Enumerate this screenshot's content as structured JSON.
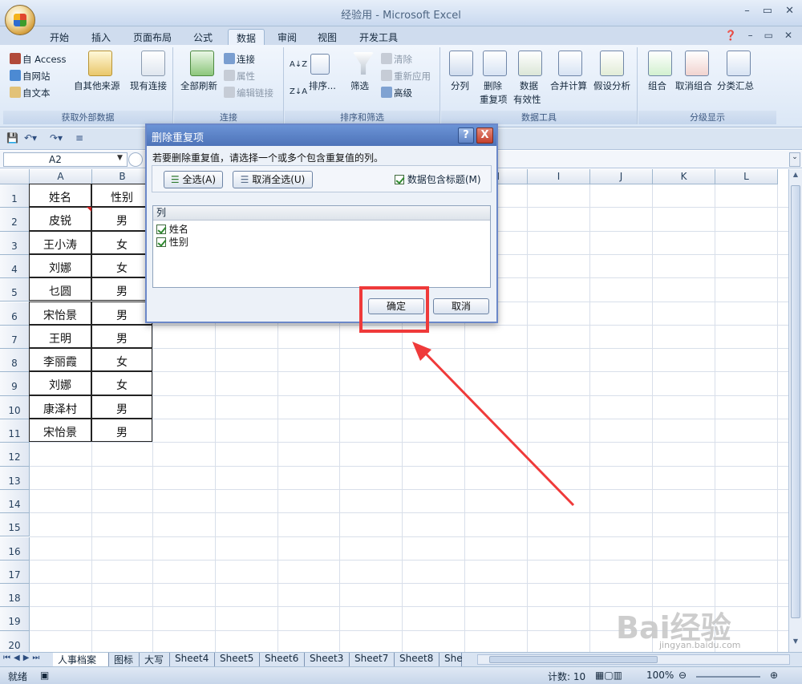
{
  "window": {
    "title": "经验用 - Microsoft Excel"
  },
  "ribbon": {
    "tabs": [
      "开始",
      "插入",
      "页面布局",
      "公式",
      "数据",
      "审阅",
      "视图",
      "开发工具"
    ],
    "active_tab": "数据",
    "groups": {
      "external": {
        "label": "获取外部数据",
        "access": "自 Access",
        "web": "自网站",
        "text": "自文本",
        "other": "自其他来源",
        "existing": "现有连接"
      },
      "connections": {
        "label": "连接",
        "refresh_all": "全部刷新",
        "connections": "连接",
        "properties": "属性",
        "edit_links": "编辑链接"
      },
      "sort_filter": {
        "label": "排序和筛选",
        "sort": "排序...",
        "filter": "筛选",
        "clear": "清除",
        "reapply": "重新应用",
        "advanced": "高级"
      },
      "data_tools": {
        "label": "数据工具",
        "text_to_columns": "分列",
        "remove_dup_1": "删除",
        "remove_dup_2": "重复项",
        "validation_1": "数据",
        "validation_2": "有效性",
        "consolidate": "合并计算",
        "what_if": "假设分析"
      },
      "outline": {
        "label": "分级显示",
        "group": "组合",
        "ungroup": "取消组合",
        "subtotal": "分类汇总"
      }
    }
  },
  "formula_bar": {
    "name_box": "A2"
  },
  "grid": {
    "columns": [
      "A",
      "B",
      "C",
      "D",
      "E",
      "F",
      "G",
      "H",
      "I",
      "J",
      "K",
      "L"
    ],
    "rows": [
      "1",
      "2",
      "3",
      "4",
      "5",
      "6",
      "7",
      "8",
      "9",
      "10",
      "11",
      "12",
      "13",
      "14",
      "15",
      "16",
      "17",
      "18",
      "19",
      "20"
    ],
    "data": [
      [
        "姓名",
        "性别"
      ],
      [
        "皮锐",
        "男"
      ],
      [
        "王小涛",
        "女"
      ],
      [
        "刘娜",
        "女"
      ],
      [
        "乜圆",
        "男"
      ],
      [
        "宋怡景",
        "男"
      ],
      [
        "王明",
        "男"
      ],
      [
        "李丽霞",
        "女"
      ],
      [
        "刘娜",
        "女"
      ],
      [
        "康泽村",
        "男"
      ],
      [
        "宋怡景",
        "男"
      ]
    ]
  },
  "sheets": {
    "tabs": [
      "人事档案",
      "图标",
      "大写",
      "Sheet4",
      "Sheet5",
      "Sheet6",
      "Sheet3",
      "Sheet7",
      "Sheet8",
      "She"
    ],
    "active": "人事档案"
  },
  "status": {
    "ready": "就绪",
    "count": "计数: 10",
    "zoom": "100%"
  },
  "dialog": {
    "title": "删除重复项",
    "help": "?",
    "close": "X",
    "instruction": "若要删除重复值，请选择一个或多个包含重复值的列。",
    "select_all": "全选(A)",
    "unselect_all": "取消全选(U)",
    "has_headers": "数据包含标题(M)",
    "list_header": "列",
    "columns": [
      "姓名",
      "性别"
    ],
    "ok": "确定",
    "cancel": "取消"
  },
  "watermark": {
    "brand": "Bai经验",
    "url": "jingyan.baidu.com"
  },
  "colors": {
    "highlight": "#ef3a3a",
    "dialog_title": "#5a80c4"
  }
}
